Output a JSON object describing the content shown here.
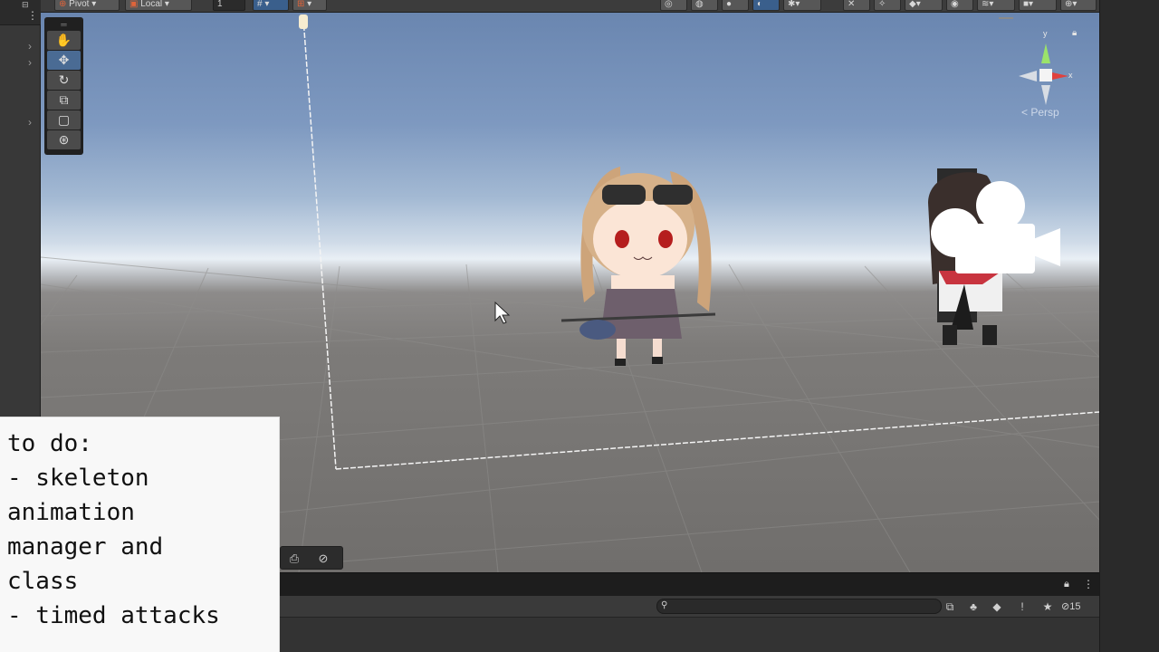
{
  "toolbar": {
    "pivot_label": "Pivot",
    "local_label": "Local",
    "grid_value": "1",
    "grid_snap_label": "#"
  },
  "viewport": {
    "persp_label": "< Persp",
    "gizmo": {
      "y_label": "y",
      "x_label": "x"
    }
  },
  "tools": [
    "hand-tool",
    "move-tool",
    "rotate-tool",
    "scale-tool",
    "rect-tool",
    "transform-tool"
  ],
  "bottom_panel": {
    "search_placeholder": "",
    "hidden_count": "15"
  },
  "note": {
    "lines": [
      "to do:",
      "- skeleton",
      "animation",
      "manager and",
      "class",
      "- timed attacks"
    ]
  },
  "colors": {
    "gizmo_y": "#9be36a",
    "gizmo_x": "#e0413e",
    "active_tool": "#4a6b94",
    "editor_dark": "#262626"
  }
}
